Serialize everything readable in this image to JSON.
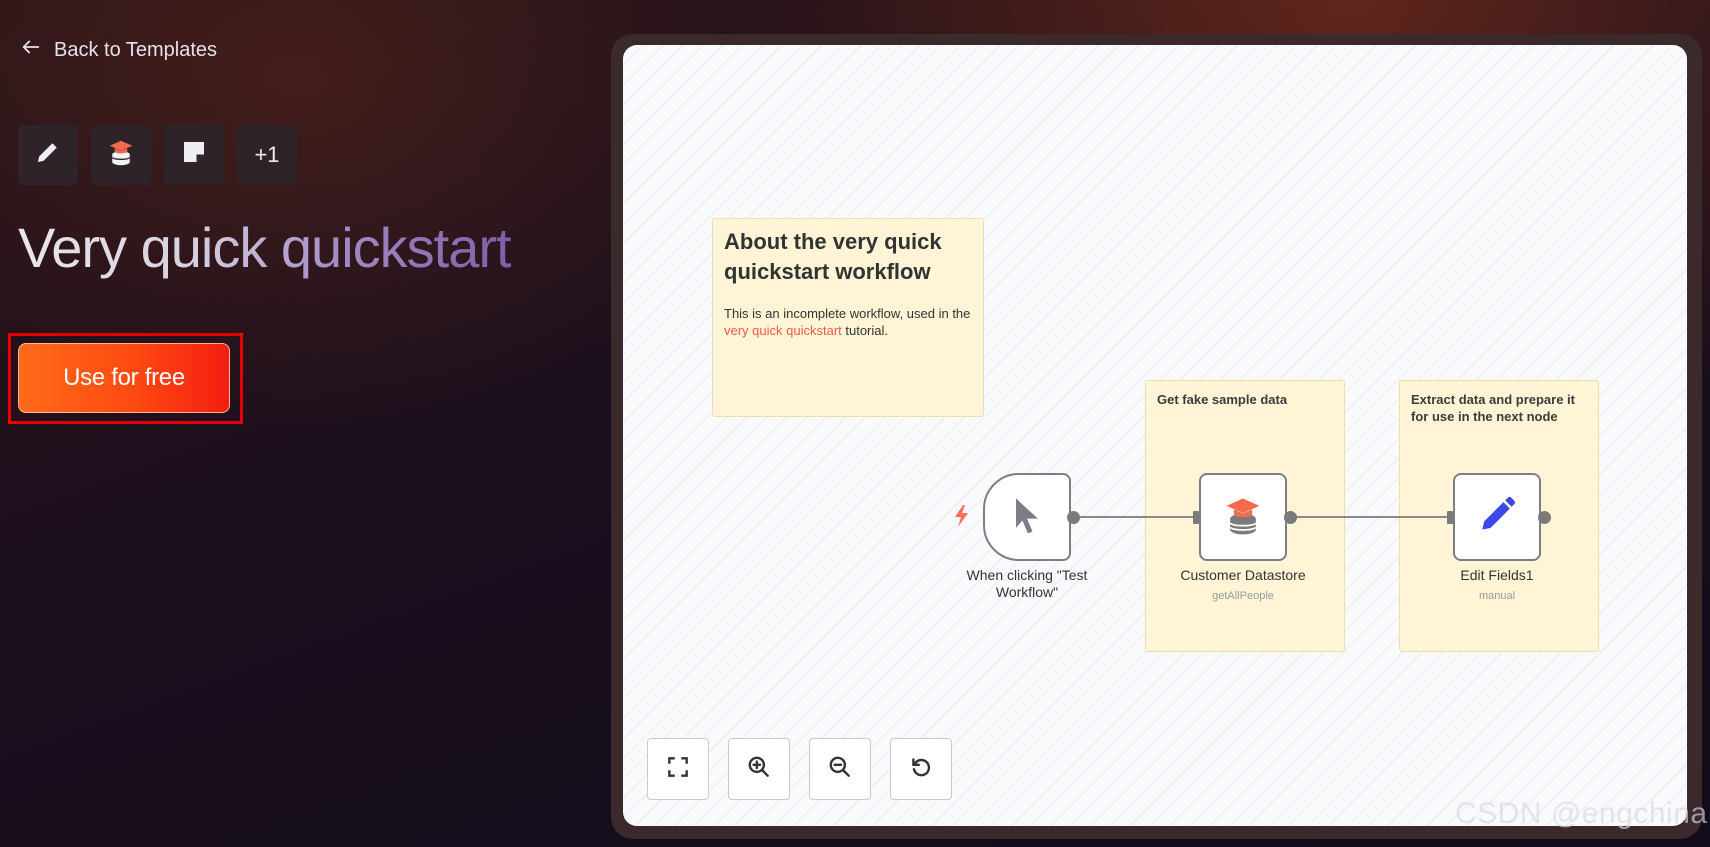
{
  "header": {
    "back_label": "Back to Templates"
  },
  "node_icons": [
    {
      "icon": "pencil-icon"
    },
    {
      "icon": "datastore-icon"
    },
    {
      "icon": "sticky-note-icon"
    },
    {
      "label": "+1"
    }
  ],
  "title": {
    "part1": "Very quick ",
    "part2": "quickstart"
  },
  "cta": {
    "label": "Use for free",
    "highlight_color": "#e60000"
  },
  "canvas": {
    "about_note": {
      "title": "About the very quick quickstart workflow",
      "body_before": "This is an incomplete workflow, used in the ",
      "link": "very quick quickstart",
      "body_after": " tutorial."
    },
    "group_notes": [
      {
        "title": "Get fake sample data"
      },
      {
        "title": "Extract data and prepare it for use in the next node"
      }
    ],
    "nodes": [
      {
        "label": "When clicking \"Test Workflow\"",
        "icon": "cursor-icon"
      },
      {
        "label": "Customer Datastore",
        "sub": "getAllPeople",
        "icon": "datastore-icon"
      },
      {
        "label": "Edit Fields1",
        "sub": "manual",
        "icon": "pencil-icon"
      }
    ],
    "controls": [
      {
        "name": "fit-view-button",
        "icon": "expand-icon"
      },
      {
        "name": "zoom-in-button",
        "icon": "zoom-in-icon"
      },
      {
        "name": "zoom-out-button",
        "icon": "zoom-out-icon"
      },
      {
        "name": "reset-zoom-button",
        "icon": "undo-icon"
      }
    ]
  },
  "watermark": "CSDN @engchina",
  "colors": {
    "accent_orange": "#ff5a1a",
    "link_red": "#f05a4a",
    "edit_blue": "#3b47e6",
    "trigger_red": "#ff6d5a"
  }
}
